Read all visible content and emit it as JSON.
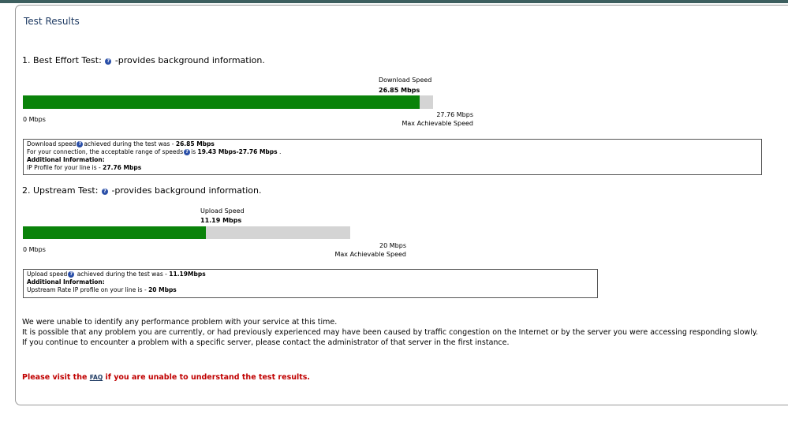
{
  "page": {
    "title": "Test Results"
  },
  "best_effort": {
    "heading": "1. Best Effort Test:",
    "heading_suffix": "-provides background information.",
    "speed_label": "Download Speed",
    "speed_value": "26.85 Mbps",
    "min_label": "0 Mbps",
    "max_value": "27.76 Mbps",
    "max_label": "Max Achievable Speed",
    "fill_fraction": 0.967,
    "info": {
      "line1_pre": "Download speed",
      "line1_mid": "achieved during the test was - ",
      "line1_val": "26.85 Mbps",
      "line2_pre": "For your connection, the acceptable range of speeds",
      "line2_mid": "is ",
      "line2_val": "19.43 Mbps-27.76 Mbps",
      "line2_post": " .",
      "line3": "Additional Information:",
      "line4_pre": "IP Profile for your line is - ",
      "line4_val": "27.76 Mbps"
    }
  },
  "upstream": {
    "heading": "2. Upstream Test:",
    "heading_suffix": "-provides background information.",
    "speed_label": "Upload Speed",
    "speed_value": "11.19 Mbps",
    "min_label": "0 Mbps",
    "max_value": "20 Mbps",
    "max_label": "Max Achievable Speed",
    "fill_fraction": 0.5595,
    "info": {
      "line1_pre": "Upload speed",
      "line1_mid": " achieved during the test was - ",
      "line1_val": "11.19Mbps",
      "line2": "Additional Information:",
      "line3_pre": "Upstream Rate IP profile on your line is - ",
      "line3_val": "20 Mbps"
    }
  },
  "messages": {
    "line1": "We were unable to identify any performance problem with your service at this time.",
    "line2": "It is possible that any problem you are currently, or had previously experienced may have been caused by traffic congestion on the Internet or by the server you were accessing responding slowly.",
    "line3": "If you continue to encounter a problem with a specific server, please contact the administrator of that server in the first instance."
  },
  "faq": {
    "pre": "Please visit the ",
    "link": "FAQ",
    "post": " if you are unable to understand the test results."
  },
  "colors": {
    "bar_fill": "#0a830a",
    "bar_track": "#d4d4d4",
    "alert_text": "#c00000",
    "help_icon": "#2a4fa8"
  },
  "icons": {
    "help": "help-question-icon"
  }
}
